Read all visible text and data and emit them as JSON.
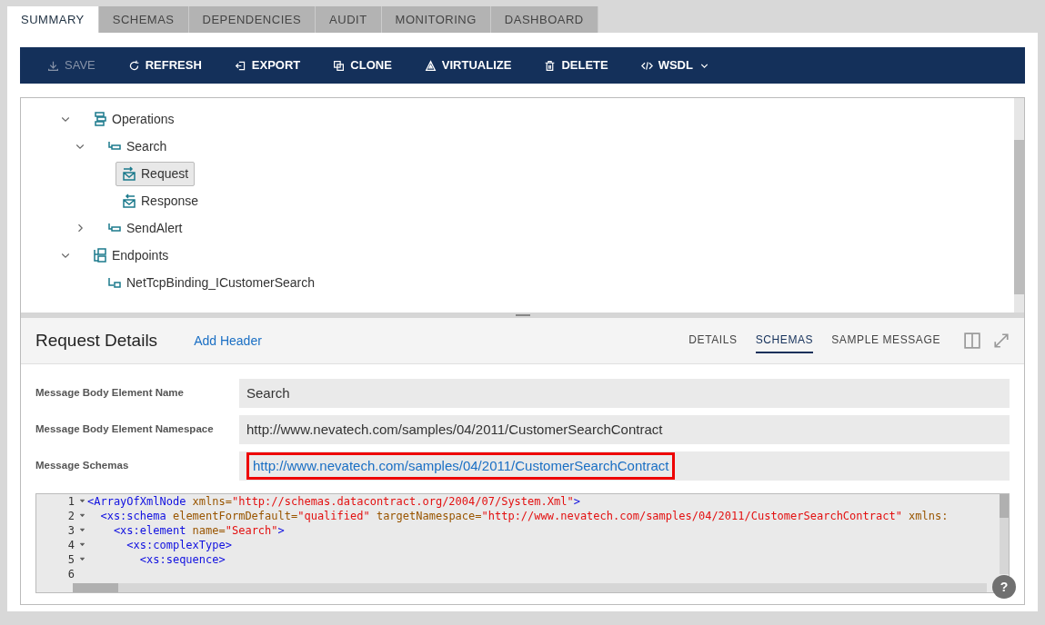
{
  "tabs": [
    {
      "label": "SUMMARY",
      "selected": true
    },
    {
      "label": "SCHEMAS",
      "selected": false
    },
    {
      "label": "DEPENDENCIES",
      "selected": false
    },
    {
      "label": "AUDIT",
      "selected": false
    },
    {
      "label": "MONITORING",
      "selected": false
    },
    {
      "label": "DASHBOARD",
      "selected": false
    }
  ],
  "toolbar": [
    {
      "kind": "save",
      "label": "SAVE",
      "disabled": true
    },
    {
      "kind": "refresh",
      "label": "REFRESH",
      "disabled": false
    },
    {
      "kind": "export",
      "label": "EXPORT",
      "disabled": false
    },
    {
      "kind": "clone",
      "label": "CLONE",
      "disabled": false
    },
    {
      "kind": "virtualize",
      "label": "VIRTUALIZE",
      "disabled": false
    },
    {
      "kind": "delete",
      "label": "DELETE",
      "disabled": false
    },
    {
      "kind": "wsdl",
      "label": "WSDL",
      "disabled": false,
      "dropdown": true
    }
  ],
  "tree": [
    {
      "kind": "operations",
      "label": "Operations",
      "expanded": true,
      "selected": false,
      "children": [
        {
          "kind": "operation",
          "label": "Search",
          "expanded": true,
          "selected": false,
          "children": [
            {
              "kind": "request",
              "label": "Request",
              "selected": true
            },
            {
              "kind": "response",
              "label": "Response",
              "selected": false
            }
          ]
        },
        {
          "kind": "operation",
          "label": "SendAlert",
          "expanded": false,
          "selected": false
        }
      ]
    },
    {
      "kind": "endpoints",
      "label": "Endpoints",
      "expanded": true,
      "selected": false,
      "children": [
        {
          "kind": "endpoint",
          "label": "NetTcpBinding_ICustomerSearch",
          "selected": false
        }
      ]
    }
  ],
  "details": {
    "title": "Request Details",
    "action": "Add Header",
    "tabs": [
      {
        "label": "DETAILS",
        "selected": false
      },
      {
        "label": "SCHEMAS",
        "selected": true
      },
      {
        "label": "SAMPLE MESSAGE",
        "selected": false
      }
    ],
    "fields": [
      {
        "label": "Message Body Element Name",
        "value": "Search",
        "kind": "text",
        "highlighted": false
      },
      {
        "label": "Message Body Element Namespace",
        "value": "http://www.nevatech.com/samples/04/2011/CustomerSearchContract",
        "kind": "text",
        "highlighted": false
      },
      {
        "label": "Message Schemas",
        "value": "http://www.nevatech.com/samples/04/2011/CustomerSearchContract",
        "kind": "link",
        "highlighted": true
      }
    ],
    "code": [
      {
        "number": "1",
        "foldable": true,
        "tokens": [
          {
            "kind": "tag",
            "text": "<ArrayOfXmlNode"
          },
          {
            "kind": "attr",
            "text": " xmlns="
          },
          {
            "kind": "string",
            "text": "\"http://schemas.datacontract.org/2004/07/System.Xml\""
          },
          {
            "kind": "tag",
            "text": ">"
          }
        ]
      },
      {
        "number": "2",
        "foldable": true,
        "tokens": [
          {
            "kind": "tag",
            "text": "  <xs:schema"
          },
          {
            "kind": "attr",
            "text": " elementFormDefault="
          },
          {
            "kind": "string",
            "text": "\"qualified\""
          },
          {
            "kind": "attr",
            "text": " targetNamespace="
          },
          {
            "kind": "string",
            "text": "\"http://www.nevatech.com/samples/04/2011/CustomerSearchContract\""
          },
          {
            "kind": "attr",
            "text": " xmlns:"
          }
        ]
      },
      {
        "number": "3",
        "foldable": true,
        "tokens": [
          {
            "kind": "tag",
            "text": "    <xs:element"
          },
          {
            "kind": "attr",
            "text": " name="
          },
          {
            "kind": "string",
            "text": "\"Search\""
          },
          {
            "kind": "tag",
            "text": ">"
          }
        ]
      },
      {
        "number": "4",
        "foldable": true,
        "tokens": [
          {
            "kind": "tag",
            "text": "      <xs:complexType>"
          }
        ]
      },
      {
        "number": "5",
        "foldable": true,
        "tokens": [
          {
            "kind": "tag",
            "text": "        <xs:sequence>"
          }
        ]
      },
      {
        "number": "6",
        "foldable": false
      }
    ]
  },
  "help": "?"
}
